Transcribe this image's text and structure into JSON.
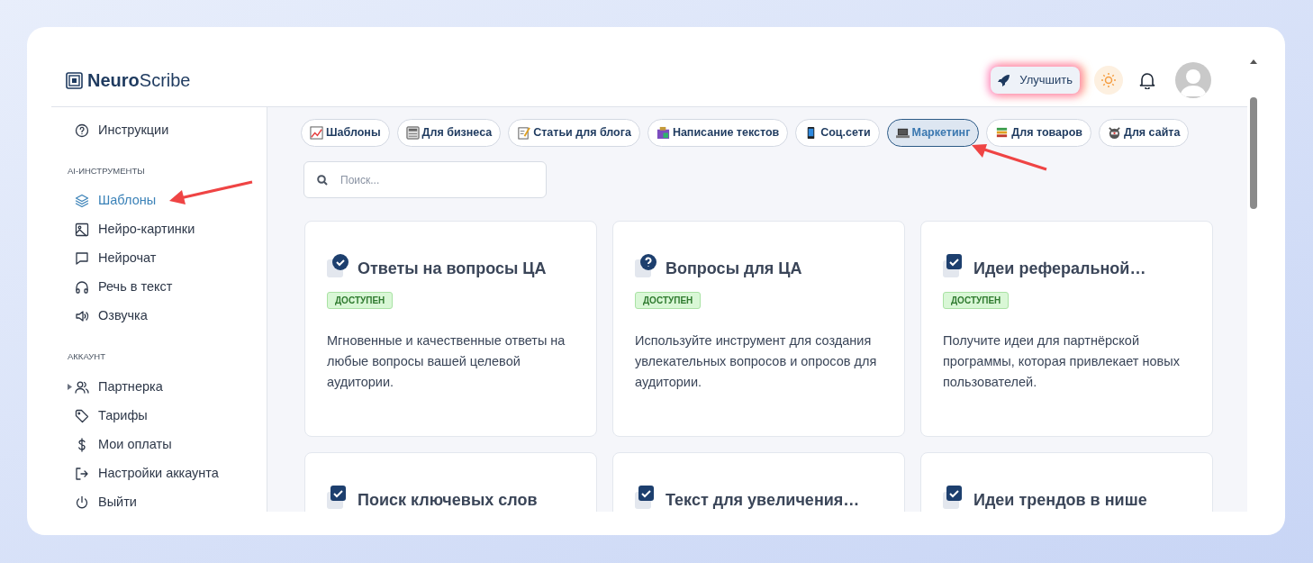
{
  "brand": {
    "bold": "Neuro",
    "regular": "Scribe"
  },
  "header": {
    "upgrade_button": "Улучшить"
  },
  "sidebar": {
    "sections": [
      {
        "items": [
          {
            "label": "Инструкции",
            "selected": false
          }
        ]
      },
      {
        "title": "AI-ИНСТРУМЕНТЫ",
        "items": [
          {
            "label": "Шаблоны",
            "selected": true
          },
          {
            "label": "Нейро-картинки",
            "selected": false
          },
          {
            "label": "Нейрочат",
            "selected": false
          },
          {
            "label": "Речь в текст",
            "selected": false
          },
          {
            "label": "Озвучка",
            "selected": false
          }
        ]
      },
      {
        "title": "АККАУНТ",
        "items": [
          {
            "label": "Партнерка",
            "selected": false,
            "expanded": false
          },
          {
            "label": "Тарифы",
            "selected": false
          },
          {
            "label": "Мои оплаты",
            "selected": false
          },
          {
            "label": "Настройки аккаунта",
            "selected": false
          },
          {
            "label": "Выйти",
            "selected": false
          }
        ]
      }
    ]
  },
  "category_chips": [
    {
      "label": "Шаблоны",
      "selected": false
    },
    {
      "label": "Для бизнеса",
      "selected": false
    },
    {
      "label": "Статьи для блога",
      "selected": false
    },
    {
      "label": "Написание текстов",
      "selected": false
    },
    {
      "label": "Соц.сети",
      "selected": false
    },
    {
      "label": "Маркетинг",
      "selected": true
    },
    {
      "label": "Для товаров",
      "selected": false
    },
    {
      "label": "Для сайта",
      "selected": false
    }
  ],
  "search": {
    "placeholder": "Поиск..."
  },
  "cards": [
    {
      "kind": "check-circle",
      "title": "Ответы на вопросы ЦА",
      "badge": "ДОСТУПЕН",
      "description": "Мгновенные и качественные ответы на любые вопросы вашей целевой аудитории."
    },
    {
      "kind": "question",
      "title": "Вопросы для ЦА",
      "badge": "ДОСТУПЕН",
      "description": "Используйте инструмент для создания увлекательных вопросов и опросов для аудитории."
    },
    {
      "kind": "check-square",
      "title": "Идеи реферальной…",
      "badge": "ДОСТУПЕН",
      "description": "Получите идеи для партнёрской программы, которая привлекает новых пользователей."
    },
    {
      "kind": "check-square",
      "title": "Поиск ключевых слов"
    },
    {
      "kind": "check-square",
      "title": "Текст для увеличения…"
    },
    {
      "kind": "check-square",
      "title": "Идеи трендов в нише"
    }
  ]
}
